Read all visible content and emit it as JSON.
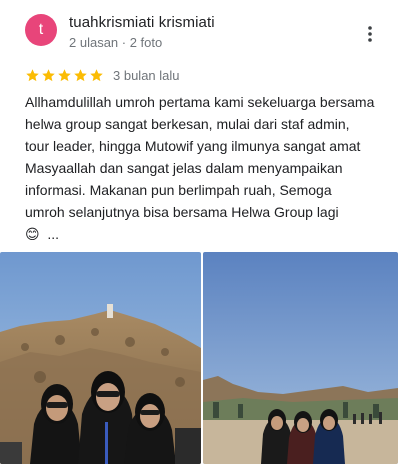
{
  "reviewer": {
    "initial": "t",
    "name": "tuahkrismiati krismiati",
    "meta": "2 ulasan · 2 foto",
    "avatar_color": "#e8457a"
  },
  "menu_icon": "more-vert-icon",
  "rating": {
    "stars": 5,
    "star_color": "#fbbc04",
    "time": "3 bulan lalu"
  },
  "review": {
    "text": "Allhamdulillah umroh pertama kami sekeluarga bersama helwa group sangat berkesan, mulai dari staf admin, tour leader, hingga Mutowif yang ilmunya sangat amat Masyaallah dan sangat jelas dalam menyampaikan informasi. Makanan pun berlimpah ruah, Semoga umroh selanjutnya bisa bersama Helwa Group lagi 😊",
    "more_label": "..."
  },
  "photos": [
    {
      "name": "review-photo-1"
    },
    {
      "name": "review-photo-2"
    }
  ]
}
